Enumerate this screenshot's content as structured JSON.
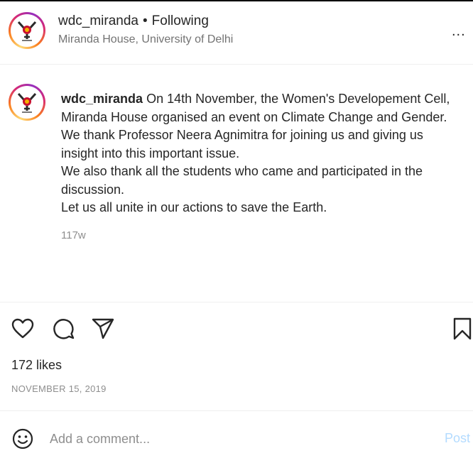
{
  "header": {
    "username": "wdc_miranda",
    "separator": "•",
    "follow_status": "Following",
    "location": "Miranda House, University of Delhi",
    "more_label": "..."
  },
  "caption": {
    "username": "wdc_miranda",
    "lines": [
      "On 14th November, the Women's Developement Cell,",
      "Miranda House organised an event on Climate Change and Gender.",
      "We thank Professor Neera Agnimitra for joining us and giving us",
      "insight into this important issue.",
      "We also thank all the students who came and participated in the",
      "discussion.",
      "Let us all unite in our actions to save the Earth."
    ],
    "age": "117w"
  },
  "engagement": {
    "likes": "172 likes",
    "date": "NOVEMBER 15, 2019"
  },
  "comment": {
    "placeholder": "Add a comment...",
    "post_label": "Post"
  },
  "colors": {
    "post_disabled": "#b3dbff",
    "secondary_text": "#8e8e8e"
  },
  "icons": [
    "avatar-logo-icon",
    "more-icon",
    "heart-icon",
    "comment-icon",
    "share-icon",
    "bookmark-icon",
    "emoji-icon"
  ]
}
